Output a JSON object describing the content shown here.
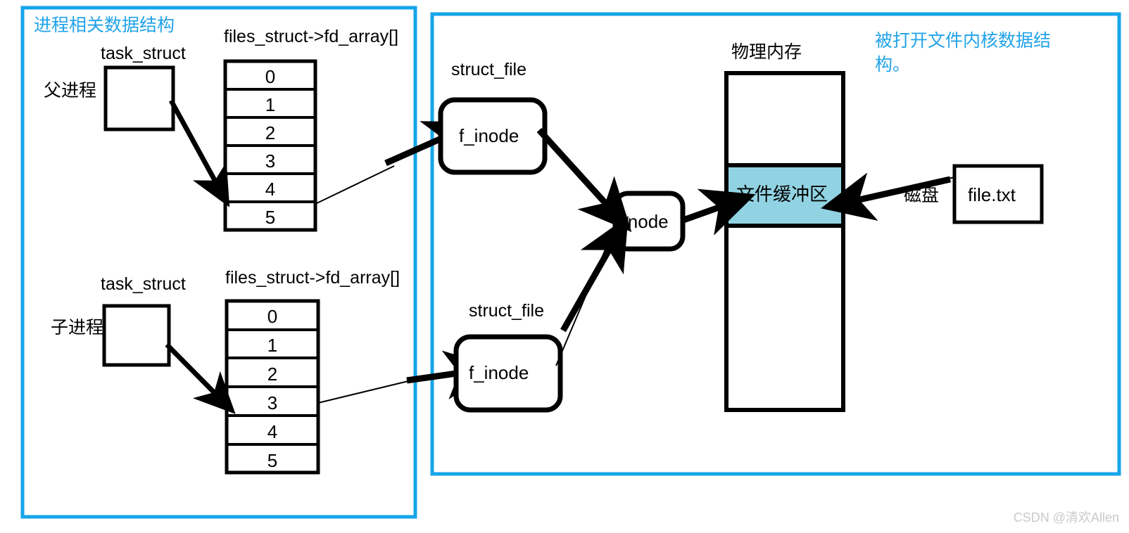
{
  "figure": {
    "watermark": "CSDN @清欢Allen"
  },
  "panels": [
    {
      "id": "process-panel",
      "title": "进程相关数据结构",
      "border_color": "#16a5e8"
    },
    {
      "id": "kernel-panel",
      "title": "被打开文件内核数据结构。",
      "border_color": "#16a5e8"
    }
  ],
  "process_panel": {
    "parent": {
      "side_label": "父进程",
      "struct_label": "task_struct",
      "array_label": "files_struct->fd_array[]",
      "cells": [
        "0",
        "1",
        "2",
        "3",
        "4",
        "5"
      ],
      "highlighted_index": 4
    },
    "child": {
      "side_label": "子进程",
      "struct_label": "task_struct",
      "array_label": "files_struct->fd_array[]",
      "cells": [
        "0",
        "1",
        "2",
        "3",
        "4",
        "5"
      ],
      "highlighted_index": 3
    }
  },
  "kernel_panel": {
    "struct_file_top": {
      "caption": "struct_file",
      "field": "f_inode"
    },
    "struct_file_bottom": {
      "caption": "struct_file",
      "field": "f_inode"
    },
    "inode": {
      "label": "inode"
    },
    "memory": {
      "caption": "物理内存",
      "buffer_label": "文件缓冲区",
      "buffer_color": "#92d3e3"
    },
    "disk": {
      "label": "磁盘",
      "file_label": "file.txt"
    }
  }
}
